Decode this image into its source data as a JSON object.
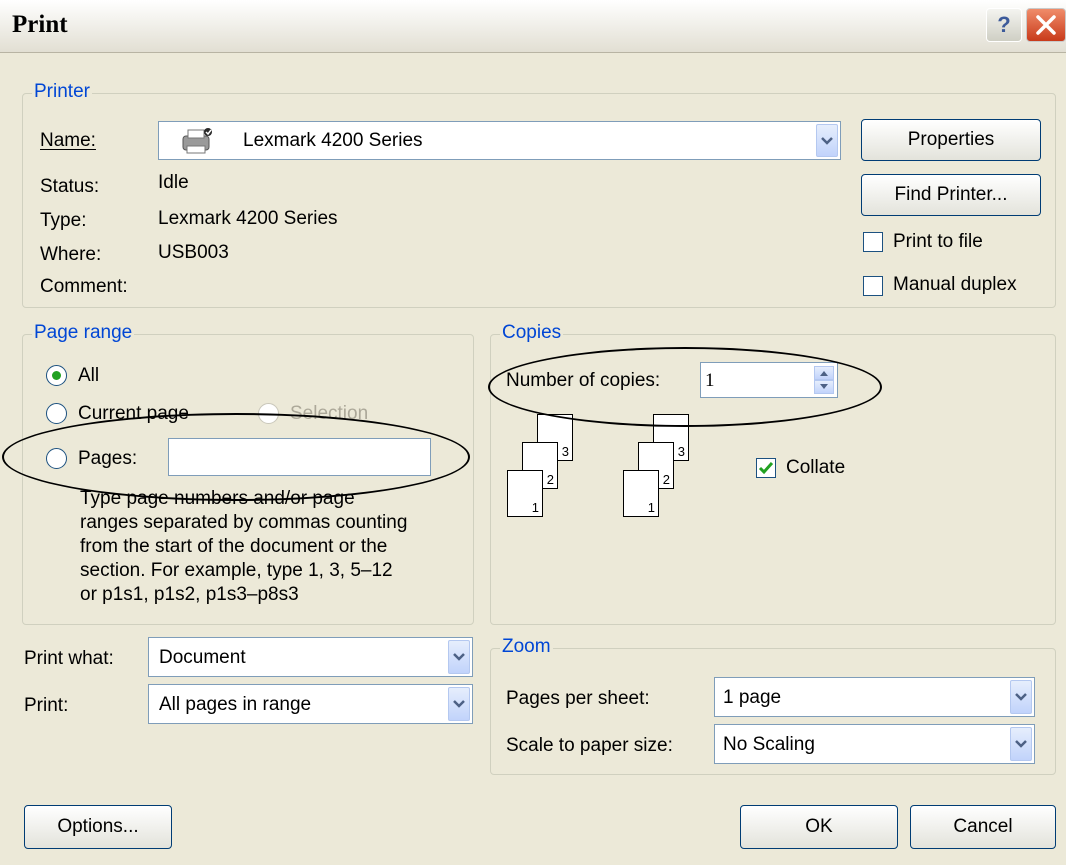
{
  "window": {
    "title": "Print",
    "help_label": "?"
  },
  "printer": {
    "group_label": "Printer",
    "name_label": "Name:",
    "name_value": "Lexmark 4200 Series",
    "status_label": "Status:",
    "status_value": "Idle",
    "type_label": "Type:",
    "type_value": "Lexmark 4200 Series",
    "where_label": "Where:",
    "where_value": "USB003",
    "comment_label": "Comment:",
    "properties_label": "Properties",
    "find_printer_label": "Find Printer...",
    "print_to_file_label": "Print to file",
    "print_to_file_checked": false,
    "manual_duplex_label": "Manual duplex",
    "manual_duplex_checked": false
  },
  "page_range": {
    "group_label": "Page range",
    "all_label": "All",
    "current_page_label": "Current page",
    "selection_label": "Selection",
    "pages_label": "Pages:",
    "pages_value": "",
    "selected": "All",
    "help_lines": [
      "Type page numbers and/or page",
      "ranges separated by commas counting",
      "from the start of the document or the",
      "section. For example, type 1, 3, 5–12",
      "or p1s1, p1s2, p1s3–p8s3"
    ]
  },
  "copies": {
    "group_label": "Copies",
    "number_label": "Number of copies:",
    "number_value": "1",
    "collate_label": "Collate",
    "collate_checked": true,
    "page_numbers": [
      "3",
      "2",
      "1"
    ]
  },
  "print_what": {
    "label": "Print what:",
    "value": "Document"
  },
  "print": {
    "label": "Print:",
    "value": "All pages in range"
  },
  "zoom": {
    "group_label": "Zoom",
    "pages_per_sheet_label": "Pages per sheet:",
    "pages_per_sheet_value": "1 page",
    "scale_label": "Scale to paper size:",
    "scale_value": "No Scaling"
  },
  "buttons": {
    "options_label": "Options...",
    "ok_label": "OK",
    "cancel_label": "Cancel"
  },
  "colors": {
    "group_label": "#0046d5",
    "dialog_bg": "#ece9d8",
    "check_green": "#21a121"
  }
}
